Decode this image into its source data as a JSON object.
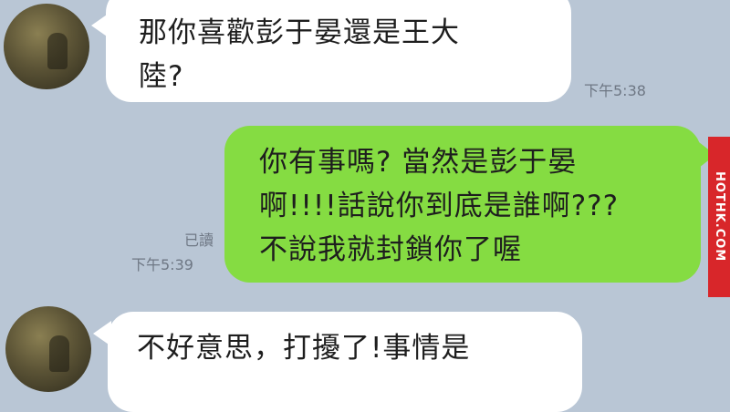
{
  "messages": [
    {
      "direction": "incoming",
      "text": "那你喜歡彭于晏還是王大\n陸?",
      "time": "下午5:38"
    },
    {
      "direction": "outgoing",
      "text": "你有事嗎? 當然是彭于晏\n啊!!!!話說你到底是誰啊???\n不說我就封鎖你了喔",
      "read_status": "已讀",
      "time": "下午5:39"
    },
    {
      "direction": "incoming",
      "text": "不好意思，打擾了!事情是"
    }
  ],
  "watermark": "HOTHK.COM",
  "colors": {
    "background": "#b9c6d5",
    "incoming_bubble": "#ffffff",
    "outgoing_bubble": "#85dc42",
    "watermark_bg": "#d8262a"
  }
}
